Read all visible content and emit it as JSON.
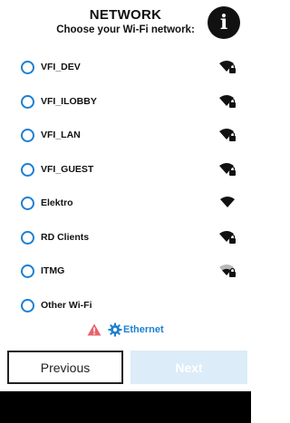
{
  "header": {
    "title": "NETWORK",
    "subtitle": "Choose your Wi-Fi network:",
    "info_icon_glyph": "i"
  },
  "networks": [
    {
      "name": "VFI_DEV",
      "signal": "full",
      "locked": true
    },
    {
      "name": "VFI_ILOBBY",
      "signal": "full",
      "locked": true
    },
    {
      "name": "VFI_LAN",
      "signal": "full",
      "locked": true
    },
    {
      "name": "VFI_GUEST",
      "signal": "full",
      "locked": true
    },
    {
      "name": "Elektro",
      "signal": "full",
      "locked": false
    },
    {
      "name": "RD Clients",
      "signal": "full",
      "locked": true
    },
    {
      "name": "ITMG",
      "signal": "medium",
      "locked": true
    },
    {
      "name": "Other Wi-Fi",
      "signal": "none",
      "locked": false
    }
  ],
  "ethernet": {
    "label": "Ethernet",
    "warning_icon": "warning-triangle-icon",
    "settings_icon": "gear-icon"
  },
  "buttons": {
    "previous": "Previous",
    "next": "Next"
  },
  "colors": {
    "accent": "#1d7fd1",
    "warning": "#e8636b",
    "next_disabled_bg": "#dcecf8"
  }
}
